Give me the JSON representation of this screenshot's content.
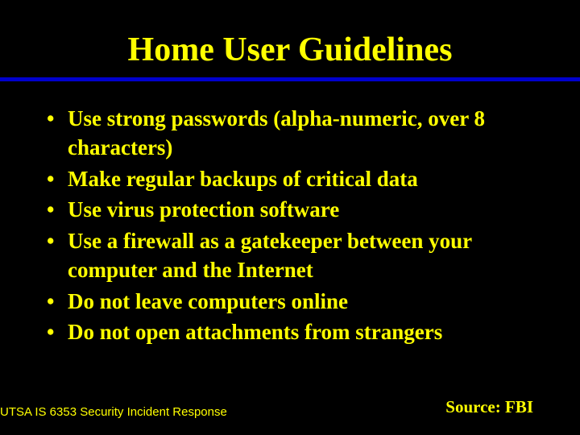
{
  "title": "Home User Guidelines",
  "bullets": [
    "Use strong passwords (alpha-numeric, over 8 characters)",
    "Make regular backups of critical data",
    "Use virus protection software",
    "Use a firewall as a gatekeeper between your computer and the Internet",
    "Do not leave computers online",
    "Do not open attachments from strangers"
  ],
  "footer_left": "UTSA IS 6353 Security Incident Response",
  "footer_right": "Source: FBI"
}
